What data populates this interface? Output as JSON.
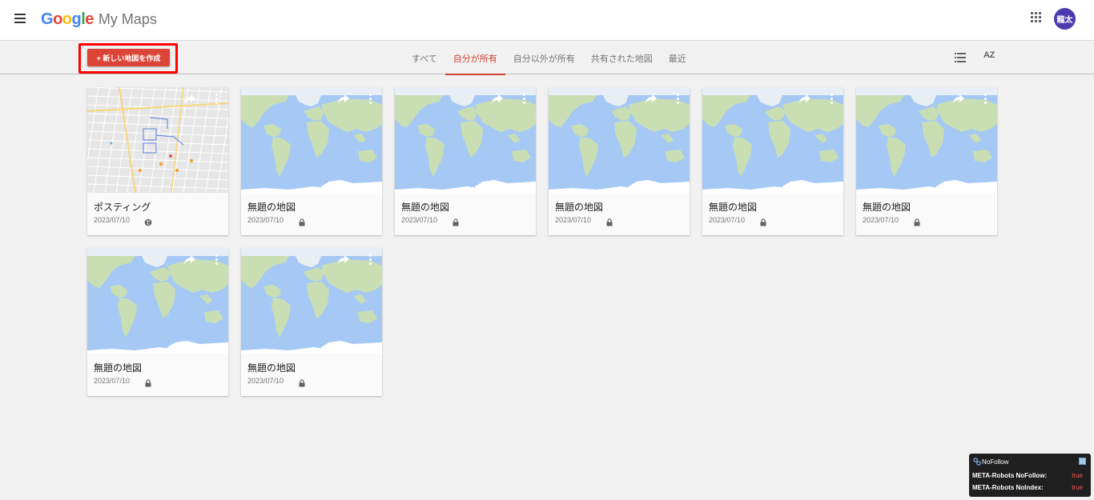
{
  "header": {
    "logo_google": [
      "G",
      "o",
      "o",
      "g",
      "l",
      "e"
    ],
    "logo_product": "My Maps",
    "avatar_text": "龍太"
  },
  "toolbar": {
    "create_label": "+ 新しい地図を作成",
    "tabs": [
      {
        "label": "すべて",
        "active": false
      },
      {
        "label": "自分が所有",
        "active": true
      },
      {
        "label": "自分以外が所有",
        "active": false
      },
      {
        "label": "共有された地図",
        "active": false
      },
      {
        "label": "最近",
        "active": false
      }
    ],
    "sort_label": "AZ"
  },
  "maps": [
    {
      "title": "ポスティング",
      "date": "2023/07/10",
      "visibility": "globe-icon",
      "thumb": "street"
    },
    {
      "title": "無題の地図",
      "date": "2023/07/10",
      "visibility": "lock-icon",
      "thumb": "world"
    },
    {
      "title": "無題の地図",
      "date": "2023/07/10",
      "visibility": "lock-icon",
      "thumb": "world"
    },
    {
      "title": "無題の地図",
      "date": "2023/07/10",
      "visibility": "lock-icon",
      "thumb": "world"
    },
    {
      "title": "無題の地図",
      "date": "2023/07/10",
      "visibility": "lock-icon",
      "thumb": "world"
    },
    {
      "title": "無題の地図",
      "date": "2023/07/10",
      "visibility": "lock-icon",
      "thumb": "world"
    },
    {
      "title": "無題の地図",
      "date": "2023/07/10",
      "visibility": "lock-icon",
      "thumb": "world"
    },
    {
      "title": "無題の地図",
      "date": "2023/07/10",
      "visibility": "lock-icon",
      "thumb": "world"
    }
  ],
  "extension": {
    "title": "NoFollow",
    "rows": [
      {
        "label": "META-Robots NoFollow:",
        "value": "true"
      },
      {
        "label": "META-Robots NoIndex:",
        "value": "true"
      }
    ]
  },
  "colors": {
    "accent": "#d23f31",
    "create_button": "#db4437",
    "highlight_box": "#ff0000",
    "avatar": "#4b3ab0",
    "ocean": "#a6c8f5",
    "land": "#c9dfb3"
  }
}
